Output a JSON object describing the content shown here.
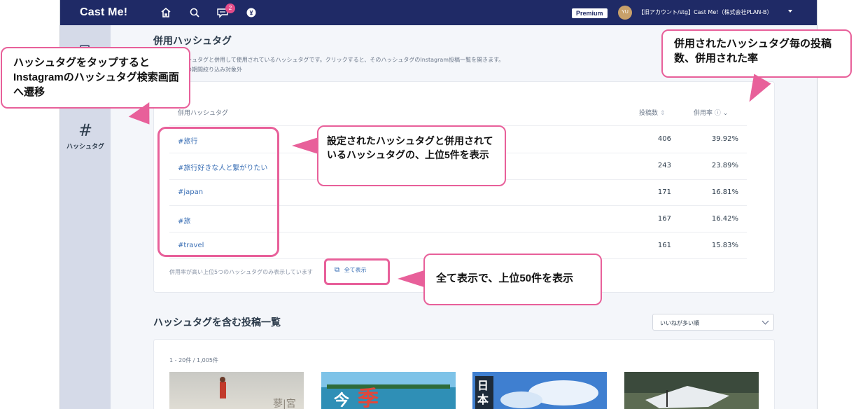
{
  "app": {
    "logo": "Cast Me!",
    "notification_count": "2",
    "premium": "Premium",
    "avatar_initials": "YU",
    "account_name": "【旧アカウント/stg】Cast Me!（株式会社PLAN-B）"
  },
  "sidebar": {
    "hashtag_glyph": "#",
    "hashtag_label": "ハッシュタグ"
  },
  "cooccur": {
    "title": "併用ハッシュタグ",
    "desc1": "シュタグと併用して使用されているハッシュタグです。クリックすると、そのハッシュタグのInstagram投稿一覧を開きます。",
    "desc2": "の期間絞り込み対象外",
    "col_tag": "併用ハッシュタグ",
    "col_posts": "投稿数",
    "col_rate": "併用率",
    "rows": [
      {
        "tag": "#旅行",
        "posts": "406",
        "rate": "39.92%"
      },
      {
        "tag": "#旅行好きな人と繋がりたい",
        "posts": "243",
        "rate": "23.89%"
      },
      {
        "tag": "#japan",
        "posts": "171",
        "rate": "16.81%"
      },
      {
        "tag": "#旅",
        "posts": "167",
        "rate": "16.42%"
      },
      {
        "tag": "#travel",
        "posts": "161",
        "rate": "15.83%"
      }
    ],
    "note": "併用率が高い上位5つのハッシュタグのみ表示しています",
    "show_all": "全て表示"
  },
  "posts": {
    "title": "ハッシュタグを含む投稿一覧",
    "sort_selected": "いいねが多い順",
    "range": "1 - 20件 / 1,005件"
  },
  "annotations": {
    "tap": "ハッシュタグをタップすると Instagramのハッシュタグ検索画面へ遷移",
    "rate": "併用されたハッシュタグ毎の投稿数、併用された率",
    "top5": "設定されたハッシュタグと併用されているハッシュタグの、上位5件を表示",
    "top50": "全て表示で、上位50件を表示"
  },
  "colors": {
    "nav": "#1f2a66",
    "accent": "#e8609a",
    "link": "#3a6fb5"
  }
}
